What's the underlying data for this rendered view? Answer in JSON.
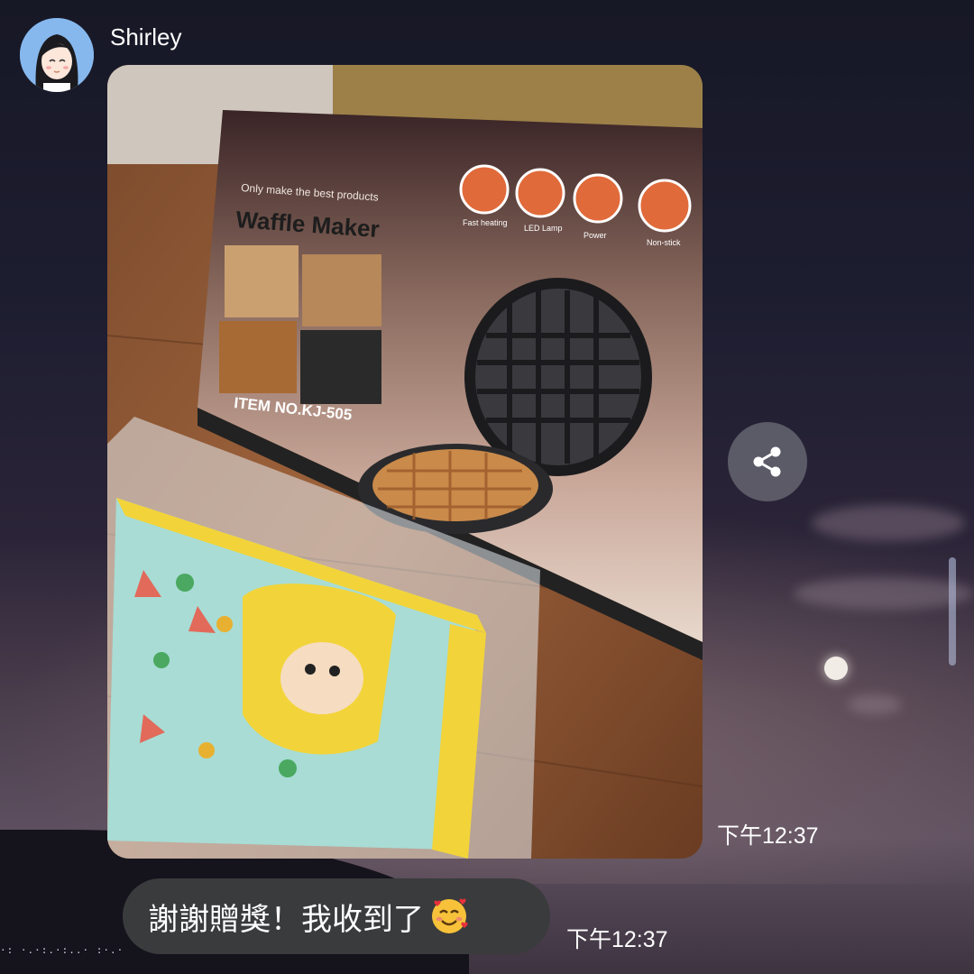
{
  "chat": {
    "sender_name": "Shirley",
    "image_message": {
      "time": "下午12:37",
      "box_text": {
        "tagline": "Only make the best products",
        "title": "Waffle Maker",
        "item_no": "ITEM NO.KJ-505",
        "features": [
          "Fast heating",
          "LED Lamp",
          "Power",
          "Non-stick"
        ]
      }
    },
    "text_message": {
      "text": "謝謝贈獎！我收到了",
      "emoji": "smiling-face-with-hearts",
      "time": "下午12:37"
    }
  },
  "icons": {
    "share": "share-icon"
  }
}
